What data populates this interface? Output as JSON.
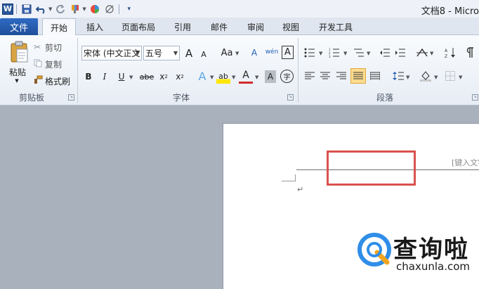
{
  "window": {
    "title": "文档8 - Micro"
  },
  "quick_access": {
    "icons": [
      "word-logo",
      "save-icon",
      "undo-icon",
      "redo-icon",
      "format-painter-icon",
      "color-icon",
      "strike-icon",
      "customize-icon"
    ]
  },
  "tabs": {
    "file": "文件",
    "items": [
      "开始",
      "插入",
      "页面布局",
      "引用",
      "邮件",
      "审阅",
      "视图",
      "开发工具"
    ],
    "active": "开始"
  },
  "clipboard": {
    "paste": "粘贴",
    "cut": "剪切",
    "copy": "复制",
    "format_painter": "格式刷",
    "group_label": "剪贴板"
  },
  "font": {
    "font_name": "宋体 (中文正文",
    "font_size": "五号",
    "grow": "A",
    "shrink": "A",
    "change_case": "Aa",
    "clear_format": "A",
    "phonetic": "wén",
    "border_char": "A",
    "bold": "B",
    "italic": "I",
    "underline": "U",
    "strikethrough": "abe",
    "subscript": "x",
    "superscript": "x",
    "text_effects": "A",
    "highlight": "ab",
    "font_color": "A",
    "char_shading": "A",
    "enclose": "字",
    "group_label": "字体"
  },
  "paragraph": {
    "group_label": "段落"
  },
  "document": {
    "header_placeholder": "[键入文字",
    "paragraph_mark": "↵"
  },
  "watermark": {
    "brand": "查询啦",
    "url": "chaxunla.com"
  },
  "colors": {
    "accent": "#2a5699",
    "highlight_box": "#d9534f",
    "ribbon_bg": "#f3f6fa"
  }
}
